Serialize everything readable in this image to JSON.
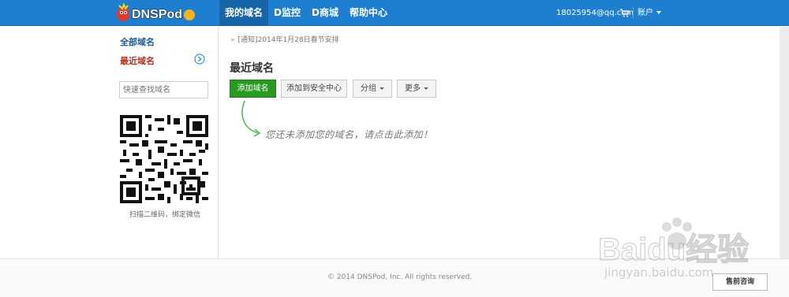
{
  "header": {
    "logo_text": "DNSPod",
    "nav": [
      {
        "label": "我的域名",
        "active": true
      },
      {
        "label": "D监控",
        "active": false
      },
      {
        "label": "D商城",
        "active": false
      },
      {
        "label": "帮助中心",
        "active": false
      }
    ],
    "user_email": "18025954@qq.com",
    "account_label": "账户"
  },
  "sidebar": {
    "all_domains": "全部域名",
    "recent_domains": "最近域名",
    "search_placeholder": "快速查找域名",
    "qr_caption": "扫描二维码，绑定微信"
  },
  "main": {
    "notice": "[通知]2014年1月28日春节安排",
    "title": "最近域名",
    "buttons": {
      "add_domain": "添加域名",
      "add_to_security": "添加到安全中心",
      "group": "分组",
      "more": "更多"
    },
    "empty_hint": "您还未添加您的域名，请点击此添加！"
  },
  "footer": {
    "copyright": "© 2014 DNSPod, Inc. All rights reserved.",
    "presale_button": "售前咨询"
  },
  "watermark": {
    "brand": "Baidu经验",
    "url": "jingyan.baidu.com"
  },
  "colors": {
    "topbar": "#1e7fd1",
    "primary_button": "#279a1f",
    "recent_link": "#b8331f"
  }
}
